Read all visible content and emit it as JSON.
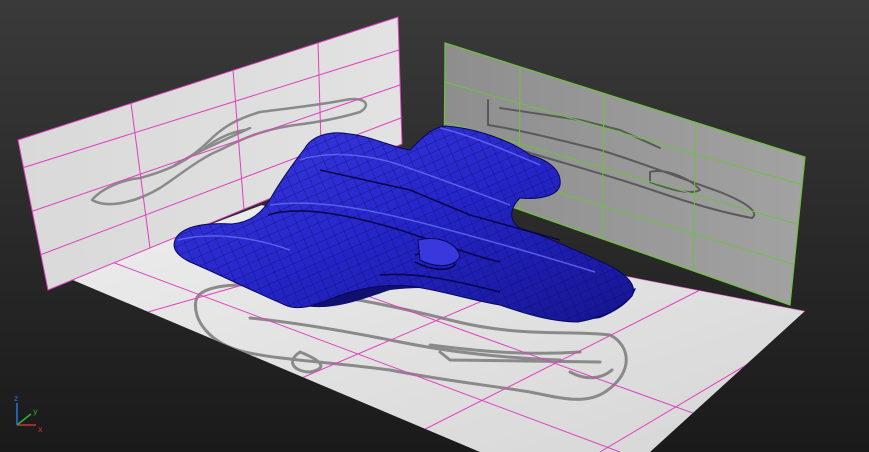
{
  "viewport": {
    "background": {
      "top": "#3a3a3a",
      "bottom": "#1a1a1a"
    },
    "mesh_color": "#2020c0",
    "mesh_wire_color": "#0a0a70",
    "left_plane_grid_color": "#e040c0",
    "back_plane_grid_color": "#70c040",
    "floor_grid_color": "#e040c0",
    "reference_sketch_color": "#888888",
    "axis_gizmo": {
      "axes": [
        {
          "label": "x",
          "color": "#d03030"
        },
        {
          "label": "y",
          "color": "#30b030"
        },
        {
          "label": "z",
          "color": "#3070e0"
        }
      ]
    }
  }
}
